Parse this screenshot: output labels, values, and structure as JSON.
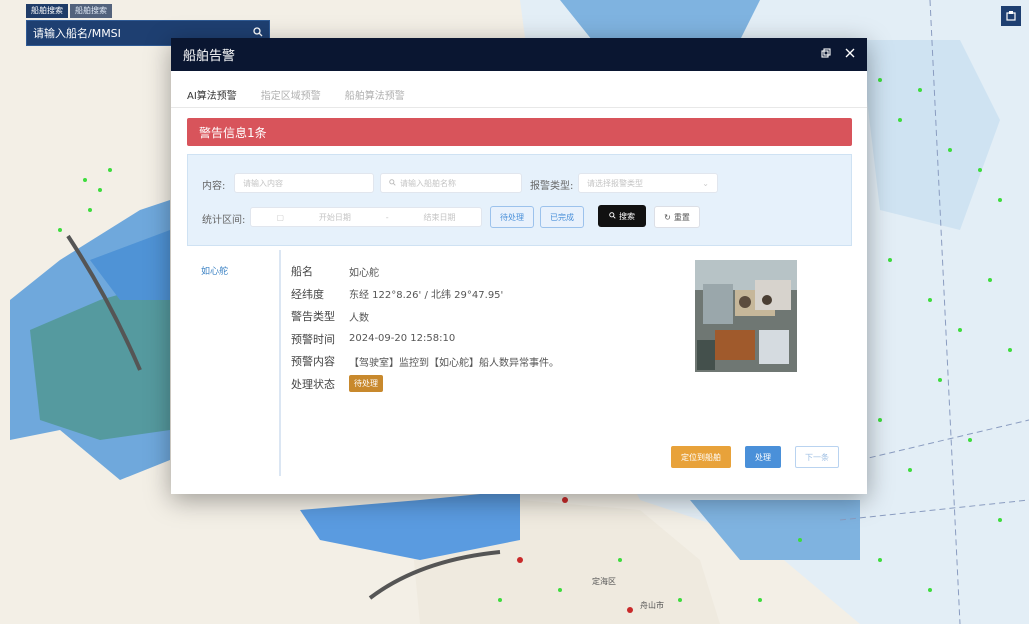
{
  "search": {
    "tabs": [
      {
        "label": "船舶搜索"
      },
      {
        "label": "船舶搜索"
      }
    ],
    "placeholder": "请输入船名/MMSI"
  },
  "dialog": {
    "title": "船舶告警",
    "tabs": [
      {
        "label": "AI算法预警"
      },
      {
        "label": "指定区域预警"
      },
      {
        "label": "船舶算法预警"
      }
    ],
    "alert_banner": "警告信息1条",
    "filters": {
      "content_label": "内容:",
      "content_placeholder": "请输入内容",
      "ship_placeholder": "请输入船舶名称",
      "type_label": "报警类型:",
      "type_placeholder": "请选择报警类型",
      "range_label": "统计区间:",
      "start_placeholder": "开始日期",
      "range_sep": "-",
      "end_placeholder": "结束日期",
      "btn_unprocessed": "待处理",
      "btn_processed": "已完成",
      "btn_search": "搜索",
      "btn_reset": "重置"
    },
    "sidebar_item": "如心舵",
    "details": {
      "name_label": "船名",
      "name_value": "如心舵",
      "coord_label": "经纬度",
      "coord_value": "东经 122°8.26' / 北纬 29°47.95'",
      "type_label": "警告类型",
      "type_value": "人数",
      "time_label": "预警时间",
      "time_value": "2024-09-20 12:58:10",
      "content_label": "预警内容",
      "content_value": "【驾驶室】监控到【如心舵】船人数异常事件。",
      "status_label": "处理状态",
      "status_value": "待处理"
    },
    "actions": {
      "view_btn": "定位到船舶",
      "handle_btn": "处理",
      "next_btn": "下一条"
    }
  },
  "map_labels": {
    "place1": "定海区",
    "place2": "舟山市"
  },
  "colors": {
    "header_bg": "#0a1631",
    "alert_red": "#d8545b",
    "status_orange": "#c8892d",
    "primary_blue": "#4a90d9",
    "vessel_green": "#3ddc3d"
  }
}
